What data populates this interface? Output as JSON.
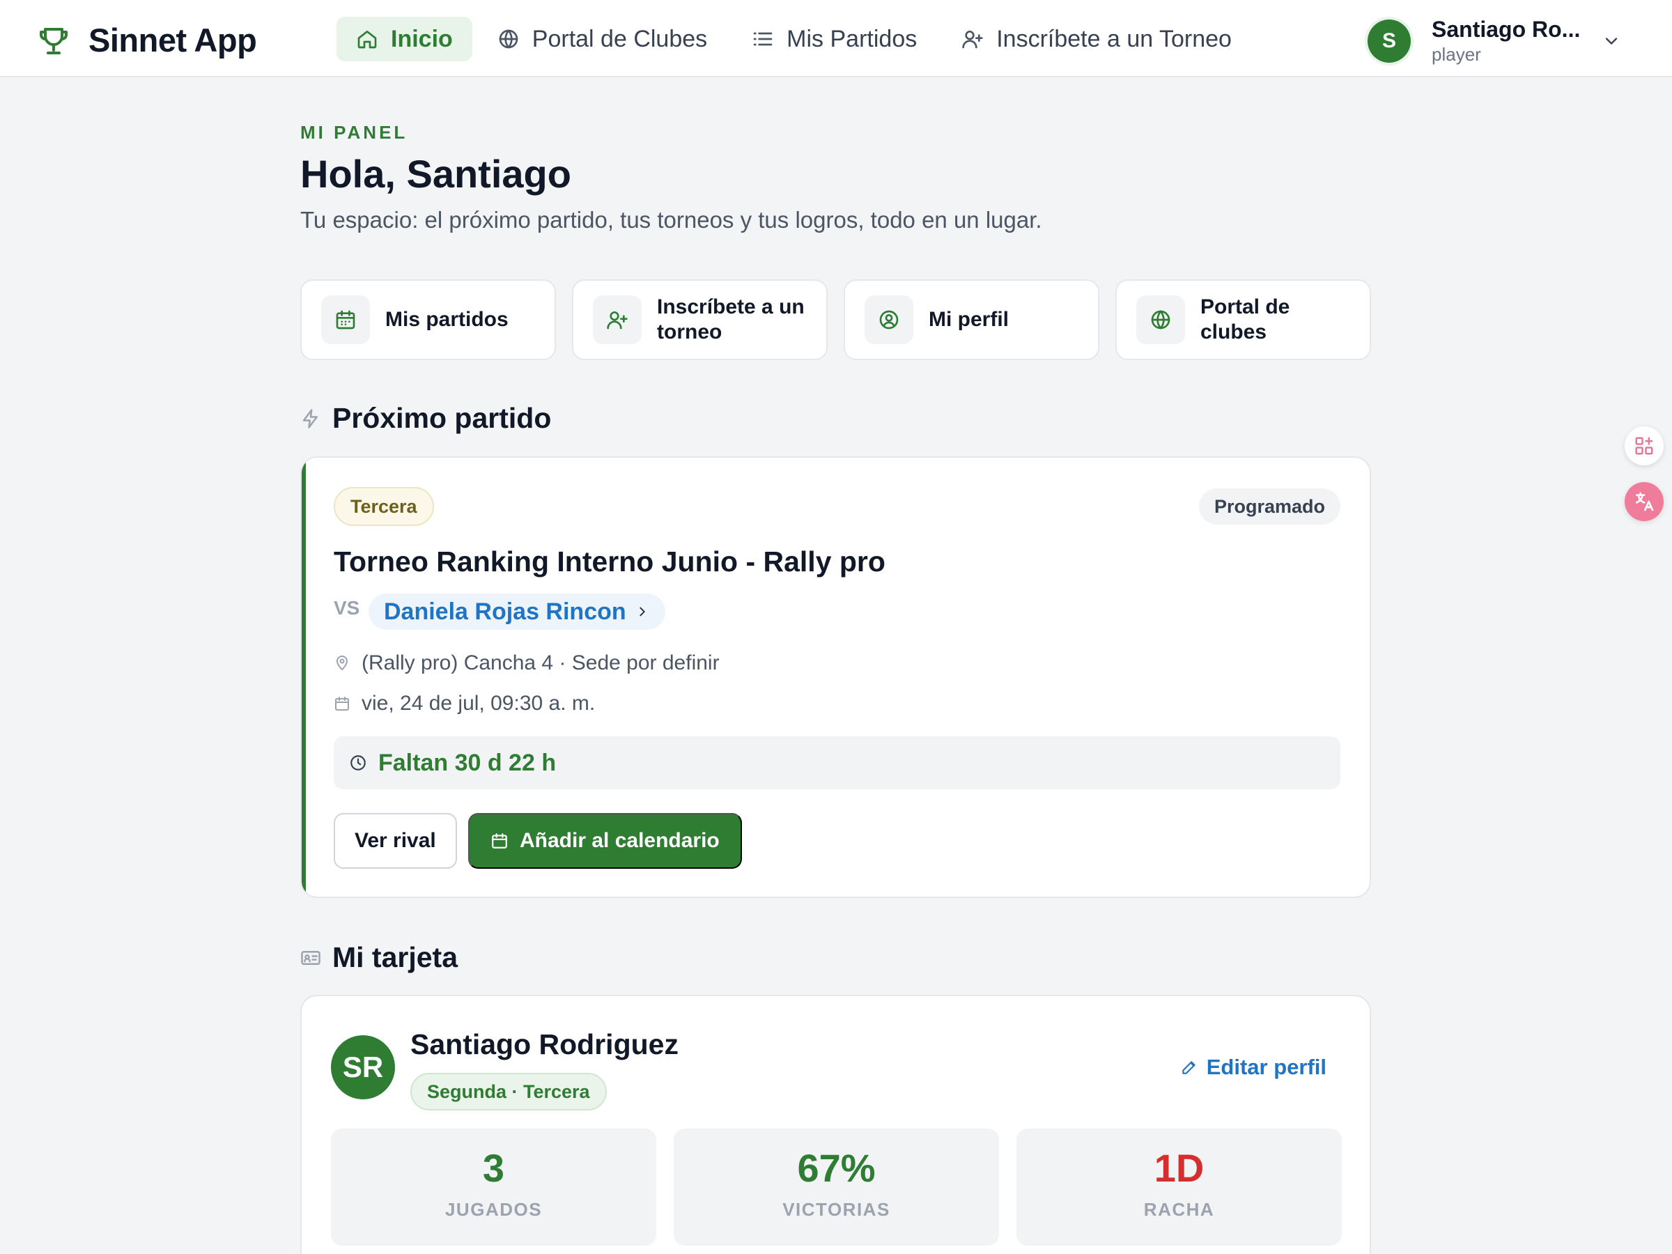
{
  "app": {
    "name": "Sinnet App"
  },
  "nav": {
    "links": [
      {
        "label": "Inicio",
        "icon": "home-icon",
        "active": true
      },
      {
        "label": "Portal de Clubes",
        "icon": "globe-icon"
      },
      {
        "label": "Mis Partidos",
        "icon": "list-icon"
      },
      {
        "label": "Inscríbete a un Torneo",
        "icon": "user-plus-icon"
      }
    ]
  },
  "user": {
    "initial": "S",
    "name": "Santiago Ro...",
    "role": "player"
  },
  "header": {
    "eyebrow": "MI PANEL",
    "title": "Hola, Santiago",
    "subtitle": "Tu espacio: el próximo partido, tus torneos y tus logros, todo en un lugar."
  },
  "quick_links": [
    {
      "label": "Mis partidos",
      "icon": "calendar-icon"
    },
    {
      "label": "Inscríbete a un torneo",
      "icon": "user-plus-icon"
    },
    {
      "label": "Mi perfil",
      "icon": "user-circle-icon"
    },
    {
      "label": "Portal de clubes",
      "icon": "globe-icon"
    }
  ],
  "next_match": {
    "section_title": "Próximo partido",
    "category": "Tercera",
    "status": "Programado",
    "title": "Torneo Ranking Interno Junio - Rally pro",
    "vs_label": "VS",
    "rival": "Daniela Rojas Rincon",
    "location": "(Rally pro) Cancha 4 · Sede por definir",
    "datetime": "vie, 24 de jul, 09:30 a. m.",
    "countdown": "Faltan 30 d 22 h",
    "btn_rival": "Ver rival",
    "btn_calendar": "Añadir al calendario"
  },
  "player_card": {
    "section_title": "Mi tarjeta",
    "initials": "SR",
    "name": "Santiago Rodriguez",
    "category": "Segunda · Tercera",
    "edit_label": "Editar perfil",
    "stats": [
      {
        "value": "3",
        "label": "JUGADOS",
        "color": "#2e7d32"
      },
      {
        "value": "67%",
        "label": "VICTORIAS",
        "color": "#2e7d32"
      },
      {
        "value": "1D",
        "label": "RACHA",
        "color": "#d32f2f"
      }
    ]
  },
  "colors": {
    "brand": "#2e7d32",
    "link": "#1f74c4",
    "danger": "#d32f2f"
  }
}
